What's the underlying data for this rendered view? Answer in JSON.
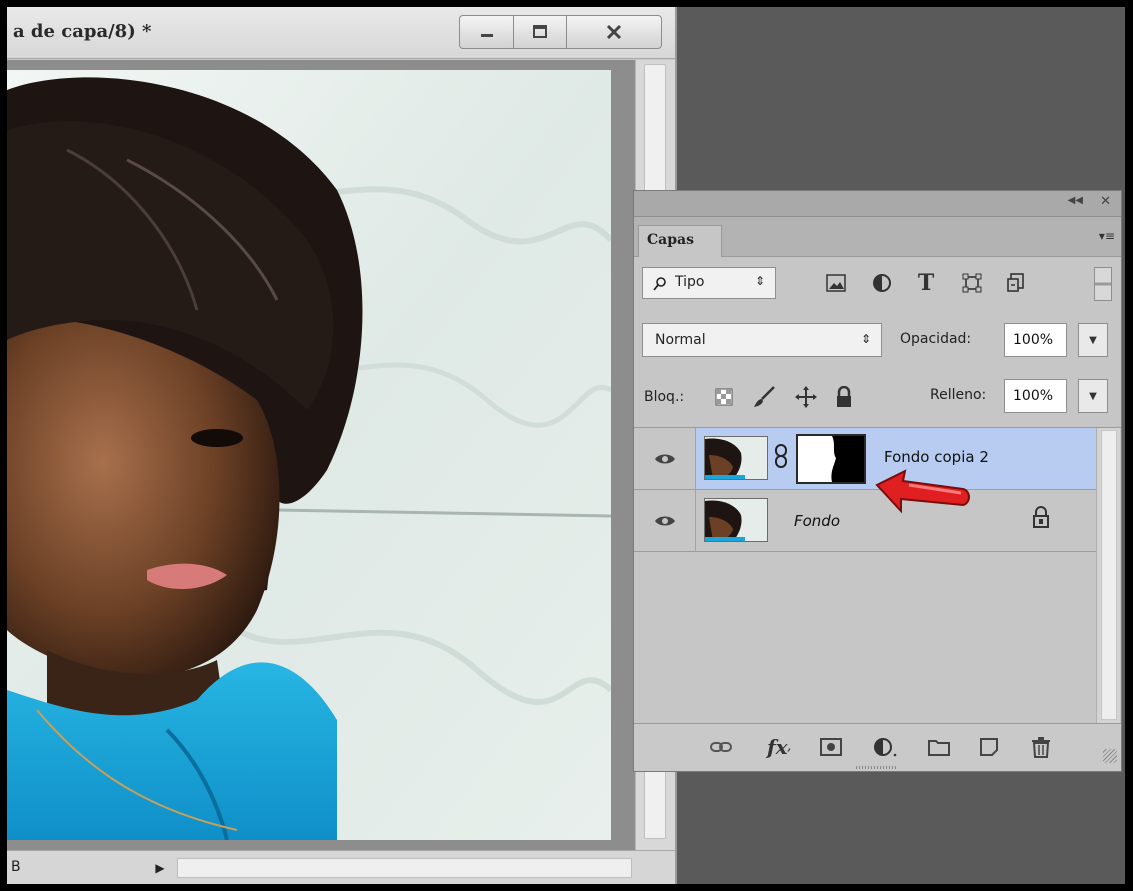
{
  "document": {
    "title": "a de capa/8) *",
    "status_text": "B"
  },
  "window_controls": {
    "minimize_icon": "minimize-icon",
    "maximize_icon": "maximize-icon",
    "close_icon": "close-icon"
  },
  "panel": {
    "tab_label": "Capas",
    "filter": {
      "selected": "Tipo",
      "icons": [
        "image-filter-icon",
        "adjustment-filter-icon",
        "type-filter-icon",
        "shape-filter-icon",
        "smart-object-filter-icon"
      ]
    },
    "blend_mode": "Normal",
    "opacity_label": "Opacidad:",
    "opacity_value": "100%",
    "lock_label": "Bloq.:",
    "lock_icons": [
      "lock-transparent-pixels-icon",
      "lock-image-pixels-icon",
      "lock-position-icon",
      "lock-all-icon"
    ],
    "fill_label": "Relleno:",
    "fill_value": "100%",
    "layers": [
      {
        "name": "Fondo copia 2",
        "visible": true,
        "selected": true,
        "has_mask": true
      },
      {
        "name": "Fondo",
        "visible": true,
        "selected": false,
        "locked": true
      }
    ],
    "footer_icons": [
      "link-layers-icon",
      "fx-icon",
      "add-mask-icon",
      "adjustment-layer-icon",
      "new-group-icon",
      "new-layer-icon",
      "trash-icon"
    ]
  },
  "colors": {
    "selected_row": "#b7ccf0",
    "panel_bg": "#c6c6c6",
    "arrow": "#e02020"
  }
}
